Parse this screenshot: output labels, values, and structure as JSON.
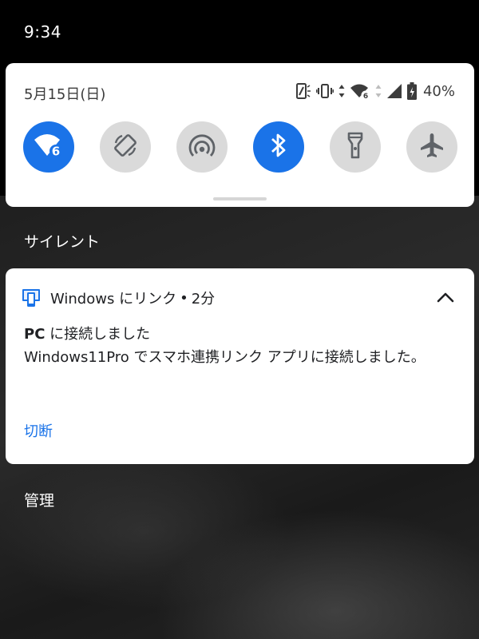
{
  "status_bar": {
    "time": "9:34"
  },
  "quick_settings": {
    "date": "5月15日(日)",
    "battery_percent": "40%",
    "wifi_badge": "6",
    "tiles": [
      {
        "name": "wifi",
        "state": "on",
        "icon": "wifi-6-icon"
      },
      {
        "name": "auto-rotate",
        "state": "off",
        "icon": "rotate-icon"
      },
      {
        "name": "hotspot",
        "state": "off",
        "icon": "hotspot-icon"
      },
      {
        "name": "bluetooth",
        "state": "on",
        "icon": "bluetooth-icon"
      },
      {
        "name": "flashlight",
        "state": "off",
        "icon": "flashlight-icon"
      },
      {
        "name": "airplane-mode",
        "state": "off",
        "icon": "airplane-icon"
      }
    ]
  },
  "sections": {
    "silent_label": "サイレント",
    "manage_label": "管理"
  },
  "notification": {
    "app_name": "Windows にリンク",
    "separator": "•",
    "time": "2分",
    "title_bold": "PC",
    "title_rest": " に接続しました",
    "body": "Windows11Pro でスマホ連携リンク アプリに接続しました。",
    "action_label": "切断"
  },
  "colors": {
    "accent": "#1a73e8",
    "tile_off": "#dadada",
    "panel": "#ffffff"
  }
}
